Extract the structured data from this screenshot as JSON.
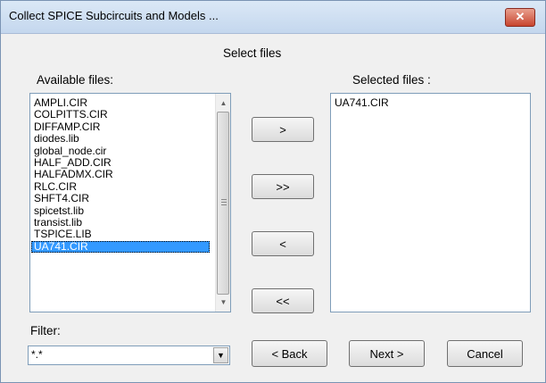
{
  "window": {
    "title": "Collect SPICE Subcircuits and Models ...",
    "close_label": "✕"
  },
  "heading": "Select files",
  "available": {
    "label": "Available files:",
    "items": [
      "AMPLI.CIR",
      "COLPITTS.CIR",
      "DIFFAMP.CIR",
      "diodes.lib",
      "global_node.cir",
      "HALF_ADD.CIR",
      "HALFADMX.CIR",
      "RLC.CIR",
      "SHFT4.CIR",
      "spicetst.lib",
      "transist.lib",
      "TSPICE.LIB",
      "UA741.CIR"
    ],
    "selected_item": "UA741.CIR"
  },
  "selected": {
    "label": "Selected files :",
    "items": [
      "UA741.CIR"
    ]
  },
  "transfer_buttons": {
    "add": ">",
    "add_all": ">>",
    "remove": "<",
    "remove_all": "<<"
  },
  "filter": {
    "label": "Filter:",
    "value": "*.*"
  },
  "buttons": {
    "back": "< Back",
    "next": "Next >",
    "cancel": "Cancel"
  },
  "icons": {
    "close": "close-icon",
    "scroll_up": "chevron-up-icon",
    "scroll_down": "chevron-down-icon",
    "dropdown": "chevron-down-icon"
  }
}
